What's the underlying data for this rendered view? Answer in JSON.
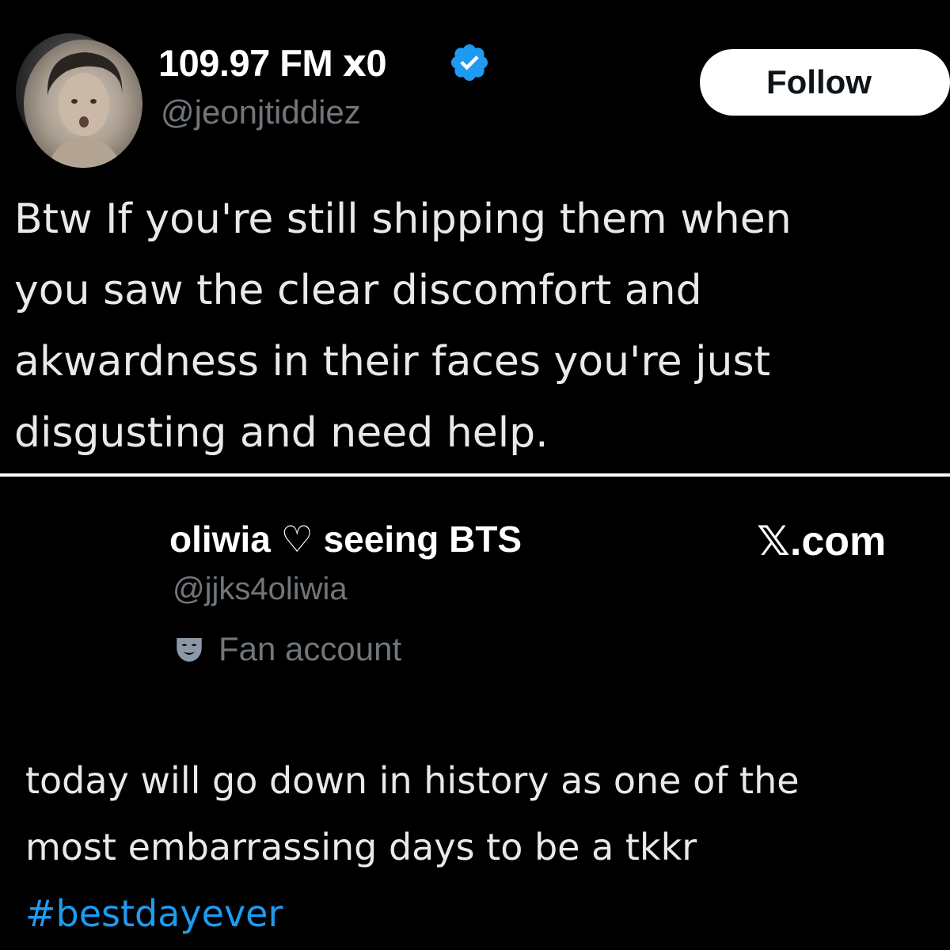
{
  "top_post": {
    "display_name": "109.97 FM ⅹ0",
    "handle": "@jeonjtiddiez",
    "follow_label": "Follow",
    "text_lines": [
      "Btw If you're still shipping them when",
      "you saw the clear discomfort and",
      "akwardness in their faces you're just",
      "disgusting and need help."
    ]
  },
  "bottom_post": {
    "display_name": "oliwia ♡ seeing BTS",
    "handle": "@jjks4oliwia",
    "account_label": "Fan account",
    "source_label": "𝕏.com",
    "text_lines": [
      "today will go down in history as one of the",
      "most embarrassing days to be a tkkr"
    ],
    "hashtag": "#bestdayever"
  },
  "colors": {
    "background": "#000000",
    "primary_text": "#e7e9ea",
    "secondary_text": "#71767b",
    "link": "#1d9bf0",
    "verified": "#1d9bf0",
    "follow_button_bg": "#ffffff"
  },
  "icons": {
    "verified": "verified-badge-icon",
    "fan_account": "mask-icon"
  }
}
